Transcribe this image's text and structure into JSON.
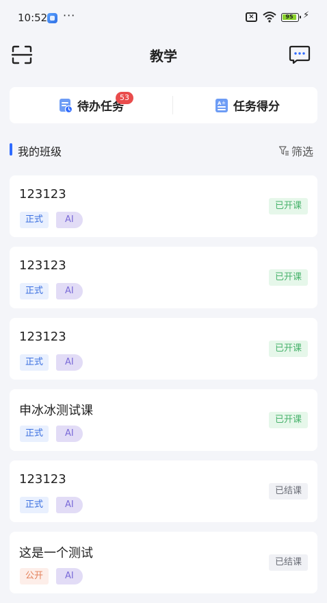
{
  "status_bar": {
    "time": "10:52",
    "dots": "···",
    "battery": "95",
    "bolt": "⚡"
  },
  "header": {
    "title": "教学"
  },
  "tabs": {
    "todo_label": "待办任务",
    "todo_badge": "53",
    "score_label": "任务得分"
  },
  "section": {
    "title": "我的班级",
    "filter_label": "筛选"
  },
  "classes": [
    {
      "name": "123123",
      "type": "正式",
      "ai": "AI",
      "status": "已开课"
    },
    {
      "name": "123123",
      "type": "正式",
      "ai": "AI",
      "status": "已开课"
    },
    {
      "name": "123123",
      "type": "正式",
      "ai": "AI",
      "status": "已开课"
    },
    {
      "name": "申冰冰测试课",
      "type": "正式",
      "ai": "AI",
      "status": "已开课"
    },
    {
      "name": "123123",
      "type": "正式",
      "ai": "AI",
      "status": "已结课"
    },
    {
      "name": "这是一个测试",
      "type": "公开",
      "ai": "AI",
      "status": "已结课"
    }
  ],
  "colors": {
    "accent": "#2f6bff",
    "badge": "#e94c4c",
    "open_status": "#47b26b",
    "closed_status": "#6a6d76"
  }
}
